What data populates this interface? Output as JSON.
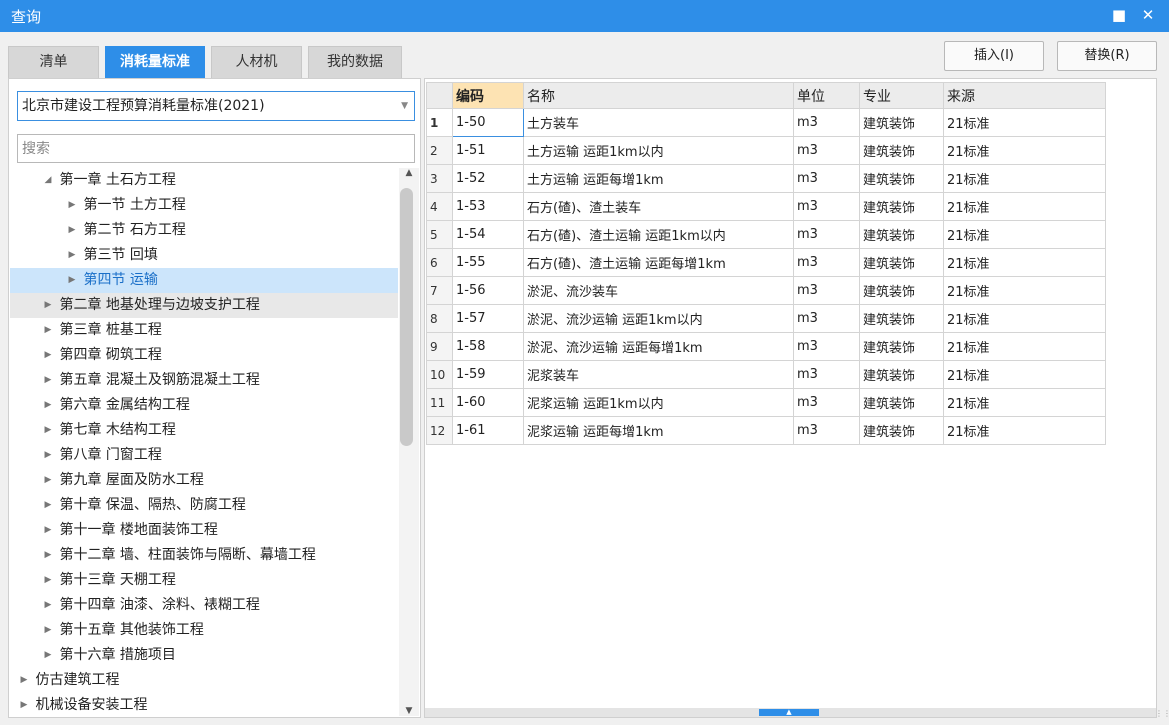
{
  "window": {
    "title": "查询",
    "minimize_icon": "minimize-icon",
    "close_icon": "close-icon"
  },
  "tabs": [
    {
      "label": "清单"
    },
    {
      "label": "消耗量标准"
    },
    {
      "label": "人材机"
    },
    {
      "label": "我的数据"
    }
  ],
  "actions": {
    "insert_label": "插入(I)",
    "replace_label": "替换(R)"
  },
  "left": {
    "standard_select": "北京市建设工程预算消耗量标准(2021)",
    "search_placeholder": "搜索",
    "tree": [
      {
        "label": "第一章 土石方工程",
        "expanded": true,
        "level": 1
      },
      {
        "label": "第一节 土方工程",
        "level": 2
      },
      {
        "label": "第二节 石方工程",
        "level": 2
      },
      {
        "label": "第三节 回填",
        "level": 2
      },
      {
        "label": "第四节 运输",
        "level": 2,
        "selected": true
      },
      {
        "label": "第二章 地基处理与边坡支护工程",
        "level": 1,
        "hover": true
      },
      {
        "label": "第三章 桩基工程",
        "level": 1
      },
      {
        "label": "第四章 砌筑工程",
        "level": 1
      },
      {
        "label": "第五章 混凝土及钢筋混凝土工程",
        "level": 1
      },
      {
        "label": "第六章 金属结构工程",
        "level": 1
      },
      {
        "label": "第七章 木结构工程",
        "level": 1
      },
      {
        "label": "第八章 门窗工程",
        "level": 1
      },
      {
        "label": "第九章 屋面及防水工程",
        "level": 1
      },
      {
        "label": "第十章 保温、隔热、防腐工程",
        "level": 1
      },
      {
        "label": "第十一章 楼地面装饰工程",
        "level": 1
      },
      {
        "label": "第十二章 墙、柱面装饰与隔断、幕墙工程",
        "level": 1
      },
      {
        "label": "第十三章 天棚工程",
        "level": 1
      },
      {
        "label": "第十四章 油漆、涂料、裱糊工程",
        "level": 1
      },
      {
        "label": "第十五章 其他装饰工程",
        "level": 1
      },
      {
        "label": "第十六章 措施项目",
        "level": 1
      },
      {
        "label": "仿古建筑工程",
        "level": 0
      },
      {
        "label": "机械设备安装工程",
        "level": 0
      }
    ]
  },
  "table": {
    "columns": [
      "编码",
      "名称",
      "单位",
      "专业",
      "来源"
    ],
    "rows": [
      [
        "1",
        "1-50",
        "土方装车",
        "m3",
        "建筑装饰",
        "21标准"
      ],
      [
        "2",
        "1-51",
        "土方运输 运距1km以内",
        "m3",
        "建筑装饰",
        "21标准"
      ],
      [
        "3",
        "1-52",
        "土方运输 运距每增1km",
        "m3",
        "建筑装饰",
        "21标准"
      ],
      [
        "4",
        "1-53",
        "石方(碴)、渣土装车",
        "m3",
        "建筑装饰",
        "21标准"
      ],
      [
        "5",
        "1-54",
        "石方(碴)、渣土运输 运距1km以内",
        "m3",
        "建筑装饰",
        "21标准"
      ],
      [
        "6",
        "1-55",
        "石方(碴)、渣土运输 运距每增1km",
        "m3",
        "建筑装饰",
        "21标准"
      ],
      [
        "7",
        "1-56",
        "淤泥、流沙装车",
        "m3",
        "建筑装饰",
        "21标准"
      ],
      [
        "8",
        "1-57",
        "淤泥、流沙运输 运距1km以内",
        "m3",
        "建筑装饰",
        "21标准"
      ],
      [
        "9",
        "1-58",
        "淤泥、流沙运输 运距每增1km",
        "m3",
        "建筑装饰",
        "21标准"
      ],
      [
        "10",
        "1-59",
        "泥浆装车",
        "m3",
        "建筑装饰",
        "21标准"
      ],
      [
        "11",
        "1-60",
        "泥浆运输 运距1km以内",
        "m3",
        "建筑装饰",
        "21标准"
      ],
      [
        "12",
        "1-61",
        "泥浆运输 运距每增1km",
        "m3",
        "建筑装饰",
        "21标准"
      ]
    ]
  }
}
